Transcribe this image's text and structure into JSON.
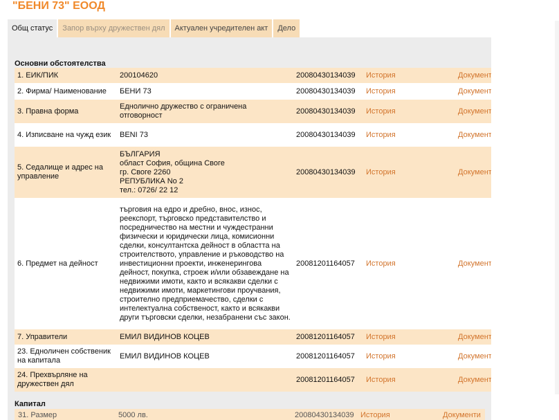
{
  "company": {
    "title": "\"БЕНИ 73\" ЕООД"
  },
  "tabs": [
    {
      "label": "Общ статус"
    },
    {
      "label": "Запор върху дружествен дял"
    },
    {
      "label": "Актуален учредителен акт"
    },
    {
      "label": "Дело"
    }
  ],
  "sections": {
    "main": "Основни обстоятелства",
    "capital": "Капитал"
  },
  "rows": [
    {
      "label": "1.  ЕИК/ПИК",
      "value": "200104620",
      "date": "20080430134039",
      "history": "История",
      "docs": "Документи"
    },
    {
      "label": "2.  Фирма/ Наименование",
      "value": "БЕНИ 73",
      "date": "20080430134039",
      "history": "История",
      "docs": "Документи"
    },
    {
      "label": "3.  Правна форма",
      "value": "Еднолично дружество с ограничена отговорност",
      "date": "20080430134039",
      "history": "История",
      "docs": "Документи"
    },
    {
      "label": "4.  Изписване на чужд език",
      "value": "BENI 73",
      "date": "20080430134039",
      "history": "История",
      "docs": "Документи"
    },
    {
      "label": "5.  Седалище и адрес на управление",
      "value": "БЪЛГАРИЯ\nобласт София, община Своге\nгр. Своге 2260\nРЕПУБЛИКА No 2\nтел.: 0726/ 22 12",
      "date": "20080430134039",
      "history": "История",
      "docs": "Документи"
    },
    {
      "label": "6.  Предмет на дейност",
      "value": "търговия на едро и дребно, внос, износ, реекспорт, търговско представителство и посредничество на местни и чуждестранни физически и юридически лица, комисионни сделки, консултантска дейност в областта на строителството, управление и ръководство на инвестиционни проекти, инженерингова дейност, покупка, строеж и/или обзавеждане на недвижими имоти, както и всякакви сделки с недвижими имоти, маркетингови проучвания, строително предприемачество, сделки с интелектуална собственост, както и всякакви други търговски сделки, незабранени със закон.",
      "date": "20081201164057",
      "history": "История",
      "docs": "Документи"
    },
    {
      "label": "7.  Управители",
      "value": "ЕМИЛ ВИДИНОВ КОЦЕВ",
      "date": "20081201164057",
      "history": "История",
      "docs": "Документи"
    },
    {
      "label": "23.  Едноличен собственик на капитала",
      "value": "ЕМИЛ ВИДИНОВ КОЦЕВ",
      "date": "20081201164057",
      "history": "История",
      "docs": "Документи"
    },
    {
      "label": "24.  Прехвърляне на дружествен дял",
      "value": "",
      "date": "20081201164057",
      "history": "История",
      "docs": "Документи"
    }
  ],
  "capital_row": {
    "label": "31.  Размер",
    "value": "5000 лв.",
    "date": "20080430134039",
    "history": "История",
    "docs": "Документи"
  }
}
